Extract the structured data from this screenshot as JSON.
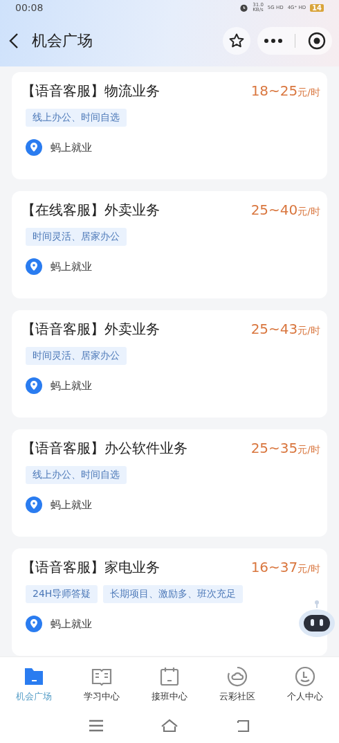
{
  "status_bar": {
    "time": "00:08",
    "speed": "31.0",
    "speed_unit": "KB/s",
    "network_1": "5G HD",
    "network_2": "4G⁺ HD",
    "battery": "14"
  },
  "header": {
    "title": "机会广场"
  },
  "jobs": [
    {
      "title": "【语音客服】物流业务",
      "price": "18~25",
      "unit": "元/时",
      "tags": [
        "线上办公、时间自选"
      ],
      "company": "蚂上就业"
    },
    {
      "title": "【在线客服】外卖业务",
      "price": "25~40",
      "unit": "元/时",
      "tags": [
        "时间灵活、居家办公"
      ],
      "company": "蚂上就业"
    },
    {
      "title": "【语音客服】外卖业务",
      "price": "25~43",
      "unit": "元/时",
      "tags": [
        "时间灵活、居家办公"
      ],
      "company": "蚂上就业"
    },
    {
      "title": "【语音客服】办公软件业务",
      "price": "25~35",
      "unit": "元/时",
      "tags": [
        "线上办公、时间自选"
      ],
      "company": "蚂上就业"
    },
    {
      "title": "【语音客服】家电业务",
      "price": "16~37",
      "unit": "元/时",
      "tags": [
        "24H导师答疑",
        "长期项目、激励多、班次充足"
      ],
      "company": "蚂上就业"
    }
  ],
  "tab_bar": [
    {
      "label": "机会广场",
      "kind": "folder",
      "selected": true
    },
    {
      "label": "学习中心",
      "kind": "book",
      "selected": false
    },
    {
      "label": "接班中心",
      "kind": "calendar",
      "selected": false
    },
    {
      "label": "云彩社区",
      "kind": "cloud",
      "selected": false
    },
    {
      "label": "个人中心",
      "kind": "clock",
      "selected": false
    }
  ]
}
